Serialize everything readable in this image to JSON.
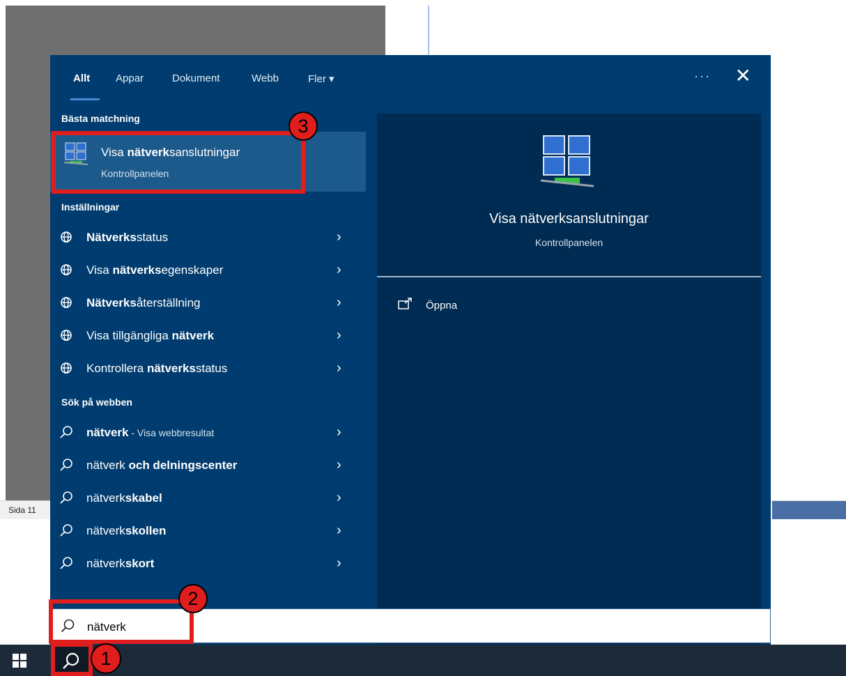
{
  "background": {
    "status_text": "Sida 11"
  },
  "panel": {
    "tabs": [
      {
        "label": "Allt",
        "active": true
      },
      {
        "label": "Appar"
      },
      {
        "label": "Dokument"
      },
      {
        "label": "Webb"
      },
      {
        "label": "Fler ▾"
      }
    ],
    "more_label": "···",
    "close_label": "✕",
    "best_match": {
      "heading": "Bästa matchning",
      "title_pre": "Visa ",
      "title_bold": "nätverk",
      "title_post": "sanslutningar",
      "subtitle": "Kontrollpanelen",
      "icon": "network-connections-icon"
    },
    "settings": {
      "heading": "Inställningar",
      "items": [
        {
          "pre": "",
          "bold": "Nätverks",
          "post": "status"
        },
        {
          "pre": "Visa ",
          "bold": "nätverks",
          "post": "egenskaper"
        },
        {
          "pre": "",
          "bold": "Nätverks",
          "post": "återställning"
        },
        {
          "pre": "Visa tillgängliga ",
          "bold": "nätverk",
          "post": ""
        },
        {
          "pre": "Kontrollera ",
          "bold": "nätverks",
          "post": "status"
        }
      ]
    },
    "web": {
      "heading": "Sök på webben",
      "first": {
        "bold": "nätverk",
        "sub": " - Visa webbresultat"
      },
      "items": [
        {
          "pre": "nätverk ",
          "bold": "och delningscenter"
        },
        {
          "pre": "nätverk",
          "bold": "skabel"
        },
        {
          "pre": "nätverk",
          "bold": "skollen"
        },
        {
          "pre": "nätverk",
          "bold": "skort"
        }
      ]
    },
    "preview": {
      "title": "Visa nätverksanslutningar",
      "subtitle": "Kontrollpanelen",
      "action": "Öppna"
    }
  },
  "search": {
    "value": "nätverk"
  },
  "annotations": {
    "badge1": "1",
    "badge2": "2",
    "badge3": "3",
    "color": "#e01e1e"
  },
  "colors": {
    "panel_bg": "#003c6f",
    "preview_bg": "#002b52",
    "selected_bg": "#1d5a8c",
    "taskbar_bg": "#1c2a3a"
  }
}
